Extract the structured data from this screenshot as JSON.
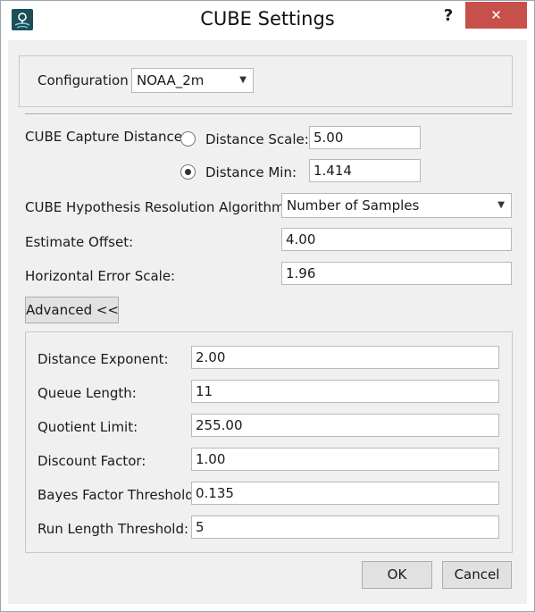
{
  "window": {
    "title": "CUBE Settings",
    "help_label": "?",
    "close_label": "✕",
    "icon": "app-logo-icon"
  },
  "configuration": {
    "label": "Configuration",
    "value": "NOAA_2m"
  },
  "capture": {
    "label": "CUBE Capture Distance:",
    "scale_label": "Distance Scale:",
    "scale_value": "5.00",
    "min_label": "Distance Min:",
    "min_value": "1.414",
    "selected": "Distance Min"
  },
  "hypothesis": {
    "label": "CUBE Hypothesis Resolution Algorithm :",
    "value": "Number of  Samples"
  },
  "estimate_offset": {
    "label": "Estimate Offset:",
    "value": "4.00"
  },
  "horizontal_error": {
    "label": "Horizontal Error Scale:",
    "value": "1.96"
  },
  "advanced_button": "Advanced <<",
  "advanced": [
    {
      "label": "Distance Exponent:",
      "value": "2.00"
    },
    {
      "label": "Queue Length:",
      "value": "11"
    },
    {
      "label": "Quotient Limit:",
      "value": "255.00"
    },
    {
      "label": "Discount Factor:",
      "value": "1.00"
    },
    {
      "label": "Bayes Factor Threshold:",
      "value": "0.135"
    },
    {
      "label": "Run Length Threshold:",
      "value": "5"
    }
  ],
  "buttons": {
    "ok": "OK",
    "cancel": "Cancel"
  },
  "colors": {
    "close_button": "#c7504a",
    "dialog_bg": "#f0f0f0",
    "app_icon": "#1d4e5a"
  }
}
